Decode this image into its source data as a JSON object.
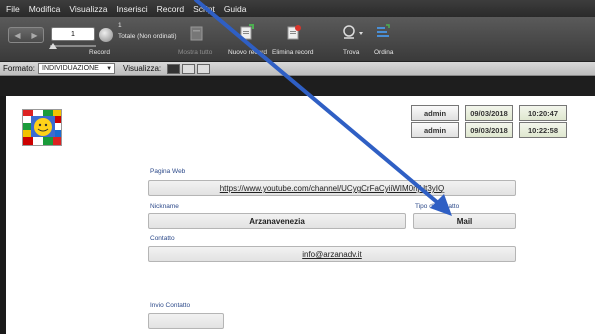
{
  "menu": {
    "items": [
      "File",
      "Modifica",
      "Visualizza",
      "Inserisci",
      "Record",
      "Script",
      "Guida"
    ]
  },
  "toolbar": {
    "record_value": "1",
    "record_count": "1",
    "record_status": "Totale (Non ordinati)",
    "record_label": "Record",
    "show_all": "Mostra tutto",
    "new_record": "Nuovo record",
    "delete_record": "Elimina record",
    "find": "Trova",
    "sort": "Ordina"
  },
  "formatbar": {
    "format_label": "Formato:",
    "format_value": "INDIVIDUAZIONE",
    "view_label": "Visualizza:"
  },
  "stamps": [
    {
      "user": "admin",
      "date": "09/03/2018",
      "time": "10:20:47"
    },
    {
      "user": "admin",
      "date": "09/03/2018",
      "time": "10:22:58"
    }
  ],
  "form": {
    "web_label": "Pagina Web",
    "web_value": "https://www.youtube.com/channel/UCygCrFaCyiiWIM0njUt3yIQ",
    "nickname_label": "Nickname",
    "nickname_value": "Arzanavenezia",
    "contact_type_label": "Tipo di contatto",
    "contact_type_value": "Mail",
    "contact_label": "Contatto",
    "contact_value": "info@arzanadv.it",
    "send_label": "Invio Contatto",
    "send_value": ""
  },
  "colors": {
    "arrow": "#2f5fc4",
    "label_blue": "#2d4a8a"
  }
}
